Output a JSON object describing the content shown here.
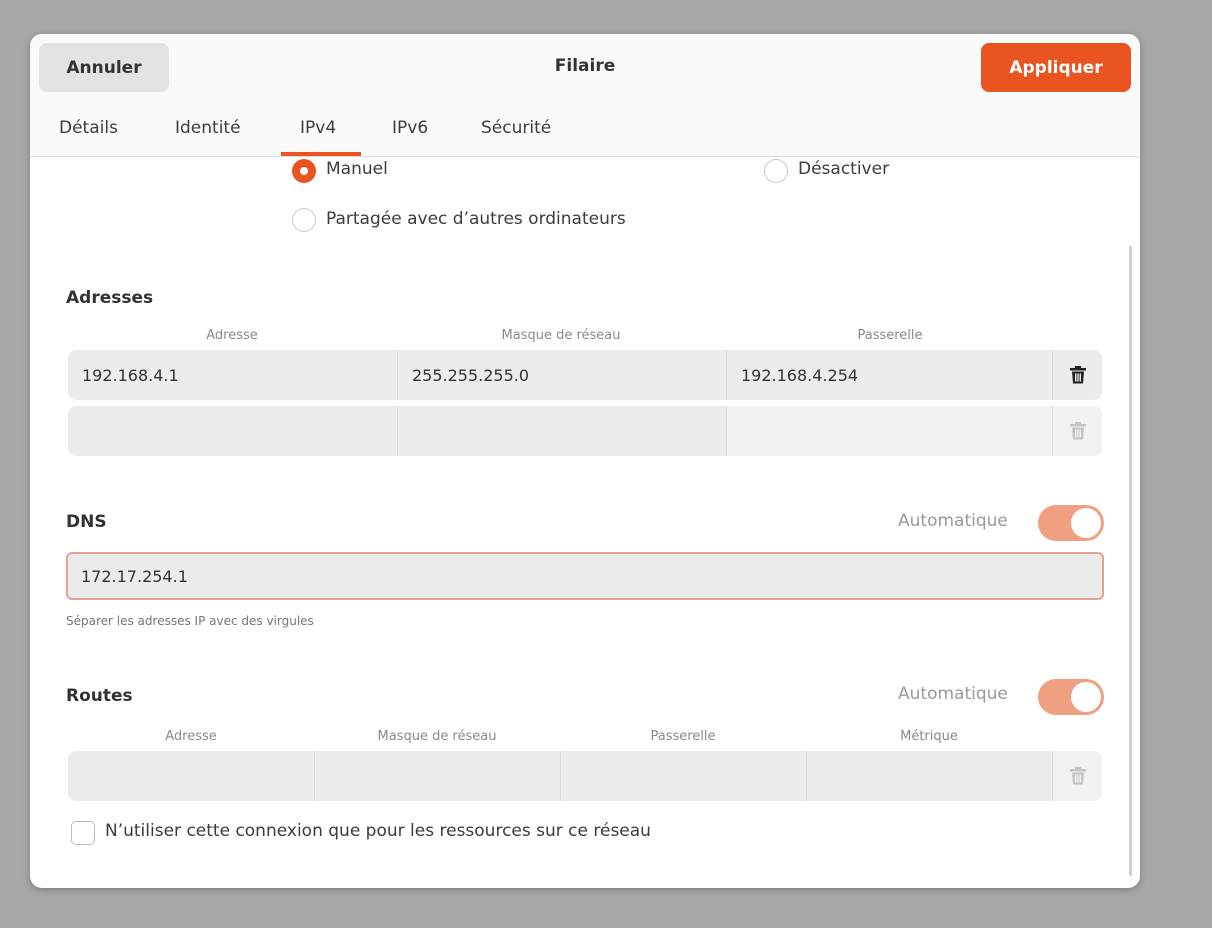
{
  "header": {
    "cancel_label": "Annuler",
    "title": "Filaire",
    "apply_label": "Appliquer"
  },
  "tabs": [
    {
      "label": "Détails"
    },
    {
      "label": "Identité"
    },
    {
      "label": "IPv4",
      "active": true
    },
    {
      "label": "IPv6"
    },
    {
      "label": "Sécurité"
    }
  ],
  "method": {
    "manual": {
      "label": "Manuel",
      "checked": true
    },
    "disable": {
      "label": "Désactiver",
      "checked": false
    },
    "shared": {
      "label": "Partagée avec d’autres ordinateurs",
      "checked": false
    }
  },
  "addresses": {
    "title": "Adresses",
    "columns": [
      "Adresse",
      "Masque de réseau",
      "Passerelle"
    ],
    "rows": [
      {
        "address": "192.168.4.1",
        "netmask": "255.255.255.0",
        "gateway": "192.168.4.254"
      },
      {
        "address": "",
        "netmask": "",
        "gateway": ""
      }
    ]
  },
  "dns": {
    "title": "DNS",
    "auto_label": "Automatique",
    "auto_on": true,
    "value": "172.17.254.1",
    "hint": "Séparer les adresses IP avec des virgules"
  },
  "routes": {
    "title": "Routes",
    "auto_label": "Automatique",
    "auto_on": true,
    "columns": [
      "Adresse",
      "Masque de réseau",
      "Passerelle",
      "Métrique"
    ],
    "only_local_label": "N’utiliser cette connexion que pour les ressources sur ce réseau",
    "only_local_checked": false
  },
  "colors": {
    "accent": "#e95420",
    "switch_on": "#f0a080"
  }
}
